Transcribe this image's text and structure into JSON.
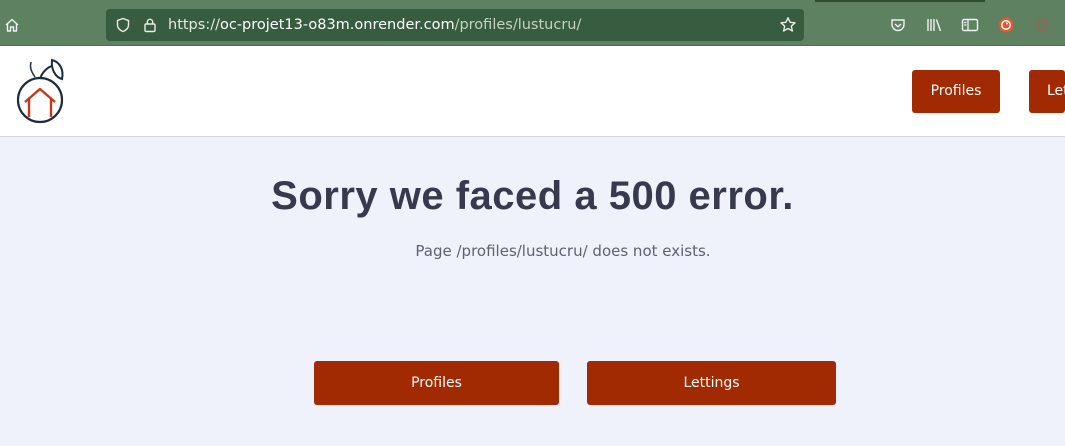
{
  "browser": {
    "url_scheme": "https://",
    "url_host": "oc-projet13-o83m.onrender.com",
    "url_path": "/profiles/lustucru/",
    "icons": [
      "home-icon",
      "shield-icon",
      "lock-icon",
      "bookmark-star-icon",
      "pocket-icon",
      "library-icon",
      "sidebar-icon",
      "duckduckgo-icon",
      "extension-icon"
    ]
  },
  "header": {
    "nav_profiles": "Profiles",
    "nav_lettings": "Let"
  },
  "main": {
    "title": "Sorry we faced a 500 error.",
    "message": "Page /profiles/lustucru/ does not exists.",
    "profiles_button": "Profiles",
    "lettings_button": "Lettings"
  },
  "colors": {
    "toolbar": "#5d8161",
    "urlbar": "#385c3f",
    "accent": "#a12a02",
    "page_bg": "#f0f2fb",
    "title_text": "#373a4c"
  }
}
